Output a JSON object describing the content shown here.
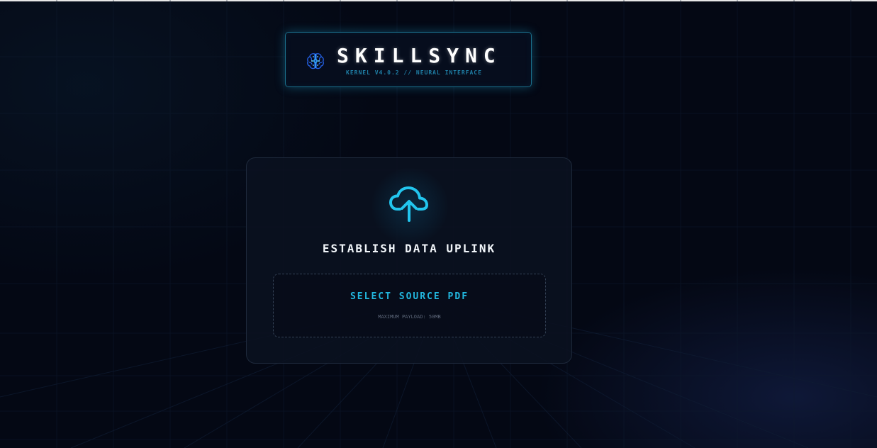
{
  "brand": {
    "icon": "brain-icon",
    "title": "SKILLSYNC",
    "subtitle": "KERNEL V4.0.2 // NEURAL INTERFACE",
    "accent_color": "#22b8e0"
  },
  "upload": {
    "icon": "cloud-upload-icon",
    "title": "ESTABLISH DATA UPLINK",
    "select_label": "SELECT SOURCE PDF",
    "hint": "MAXIMUM PAYLOAD: 50MB"
  },
  "theme": {
    "background": "#040814",
    "card_border": "#1e293b"
  }
}
